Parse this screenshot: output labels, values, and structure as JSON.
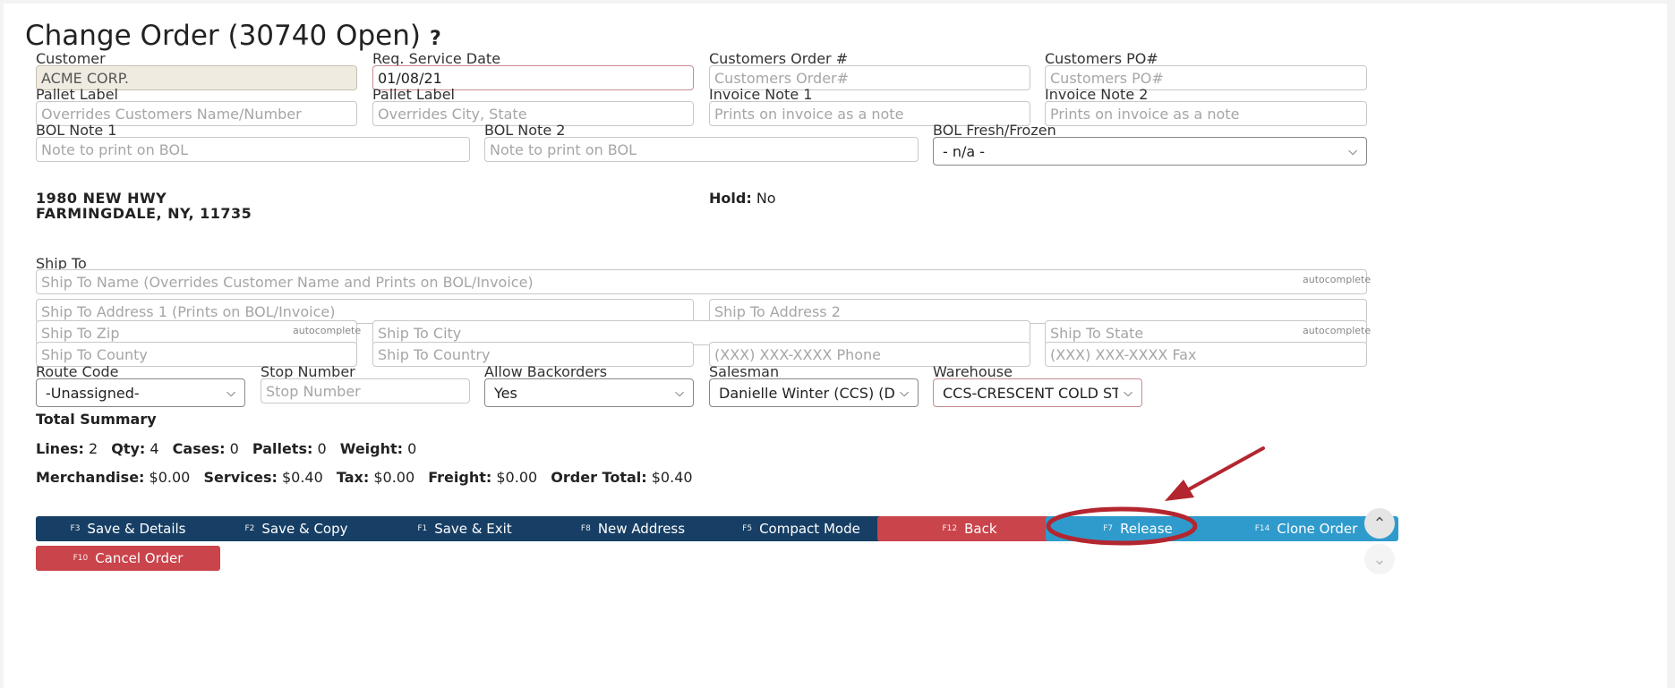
{
  "header": {
    "title": "Change Order (30740 Open)",
    "help_glyph": "?"
  },
  "order": {
    "customer_label": "Customer",
    "customer_value": "ACME CORP.",
    "req_service_date_label": "Req. Service Date",
    "req_service_date_value": "01/08/21",
    "customers_order_label": "Customers Order #",
    "customers_order_placeholder": "Customers Order#",
    "customers_po_label": "Customers PO#",
    "customers_po_placeholder": "Customers PO#",
    "pallet_label_1_label": "Pallet Label",
    "pallet_label_1_placeholder": "Overrides Customers Name/Number",
    "pallet_label_2_label": "Pallet Label",
    "pallet_label_2_placeholder": "Overrides City, State",
    "invoice_note_1_label": "Invoice Note 1",
    "invoice_note_1_placeholder": "Prints on invoice as a note",
    "invoice_note_2_label": "Invoice Note 2",
    "invoice_note_2_placeholder": "Prints on invoice as a note",
    "bol_note_1_label": "BOL Note 1",
    "bol_note_1_placeholder": "Note to print on BOL",
    "bol_note_2_label": "BOL Note 2",
    "bol_note_2_placeholder": "Note to print on BOL",
    "bol_fresh_frozen_label": "BOL Fresh/Frozen",
    "bol_fresh_frozen_value": "- n/a -"
  },
  "customer_address": {
    "line1": "1980 NEW HWY",
    "line2": "FARMINGDALE, NY, 11735",
    "hold_label": "Hold:",
    "hold_value": "No"
  },
  "ship_to": {
    "label": "Ship To",
    "autocomplete_hint": "autocomplete",
    "name_placeholder": "Ship To Name (Overrides Customer Name and Prints on BOL/Invoice)",
    "address1_placeholder": "Ship To Address 1 (Prints on BOL/Invoice)",
    "address2_placeholder": "Ship To Address 2",
    "zip_placeholder": "Ship To Zip",
    "city_placeholder": "Ship To City",
    "state_placeholder": "Ship To State",
    "county_placeholder": "Ship To County",
    "country_placeholder": "Ship To Country",
    "phone_placeholder": "(XXX) XXX-XXXX Phone",
    "fax_placeholder": "(XXX) XXX-XXXX Fax"
  },
  "routing": {
    "route_code_label": "Route Code",
    "route_code_value": "-Unassigned-",
    "stop_number_label": "Stop Number",
    "stop_number_placeholder": "Stop Number",
    "allow_backorders_label": "Allow Backorders",
    "allow_backorders_value": "Yes",
    "salesman_label": "Salesman",
    "salesman_value": "Danielle Winter (CCS) (DWIN",
    "warehouse_label": "Warehouse",
    "warehouse_value": "CCS-CRESCENT COLD STORA"
  },
  "summary": {
    "title": "Total Summary",
    "lines_label": "Lines:",
    "lines_value": "2",
    "qty_label": "Qty:",
    "qty_value": "4",
    "cases_label": "Cases:",
    "cases_value": "0",
    "pallets_label": "Pallets:",
    "pallets_value": "0",
    "weight_label": "Weight:",
    "weight_value": "0",
    "merchandise_label": "Merchandise:",
    "merchandise_value": "$0.00",
    "services_label": "Services:",
    "services_value": "$0.40",
    "tax_label": "Tax:",
    "tax_value": "$0.00",
    "freight_label": "Freight:",
    "freight_value": "$0.00",
    "order_total_label": "Order Total:",
    "order_total_value": "$0.40"
  },
  "actions": [
    {
      "key": "F3",
      "label": "Save & Details"
    },
    {
      "key": "F2",
      "label": "Save & Copy"
    },
    {
      "key": "F1",
      "label": "Save & Exit"
    },
    {
      "key": "F8",
      "label": "New Address"
    },
    {
      "key": "F5",
      "label": "Compact Mode"
    },
    {
      "key": "F12",
      "label": "Back"
    },
    {
      "key": "F7",
      "label": "Release"
    },
    {
      "key": "F14",
      "label": "Clone Order"
    },
    {
      "key": "F10",
      "label": "Cancel Order"
    }
  ],
  "scroll": {
    "up_glyph": "⌃",
    "down_glyph": "⌄"
  },
  "colors": {
    "primary_button": "#173f65",
    "danger_button": "#c9444b",
    "info_button": "#2f9bcc",
    "annotation": "#b4262f"
  },
  "icons": [
    "help-icon",
    "chevron-down-icon",
    "chevron-up-icon",
    "annotation-arrow",
    "annotation-circle"
  ]
}
